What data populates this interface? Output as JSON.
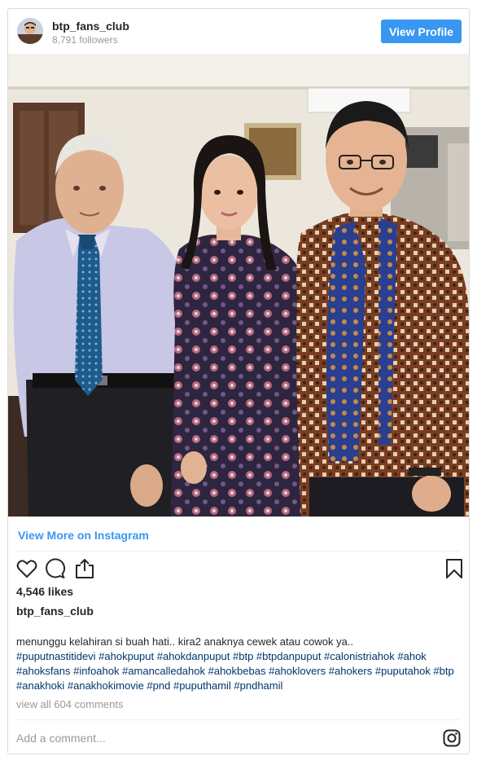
{
  "header": {
    "username": "btp_fans_club",
    "followers": "8,791 followers",
    "view_profile_label": "View Profile"
  },
  "links": {
    "view_more": "View More on Instagram"
  },
  "stats": {
    "likes": "4,546 likes"
  },
  "post": {
    "owner": "btp_fans_club",
    "caption_text": "menunggu kelahiran si buah hati.. kira2 anaknya cewek atau cowok ya..",
    "hashtags": "#puputnastitidevi #ahokpuput #ahokdanpuput #btp #btpdanpuput #calonistriahok #ahok #ahoksfans #infoahok #amancalledahok #ahokbebas #ahoklovers #ahokers #puputahok #btp #anakhoki #anakhokimovie #pnd #puputhamil #pndhamil",
    "comments_link": "view all 604 comments"
  },
  "comment_box": {
    "placeholder": "Add a comment..."
  },
  "icons": {
    "like": "heart-icon",
    "comment": "comment-bubble-icon",
    "share": "share-icon",
    "save": "bookmark-icon",
    "brand": "instagram-icon"
  },
  "colors": {
    "accent": "#3897f0",
    "hashtag": "#003569",
    "muted": "#999999",
    "border": "#dbdbdb"
  }
}
